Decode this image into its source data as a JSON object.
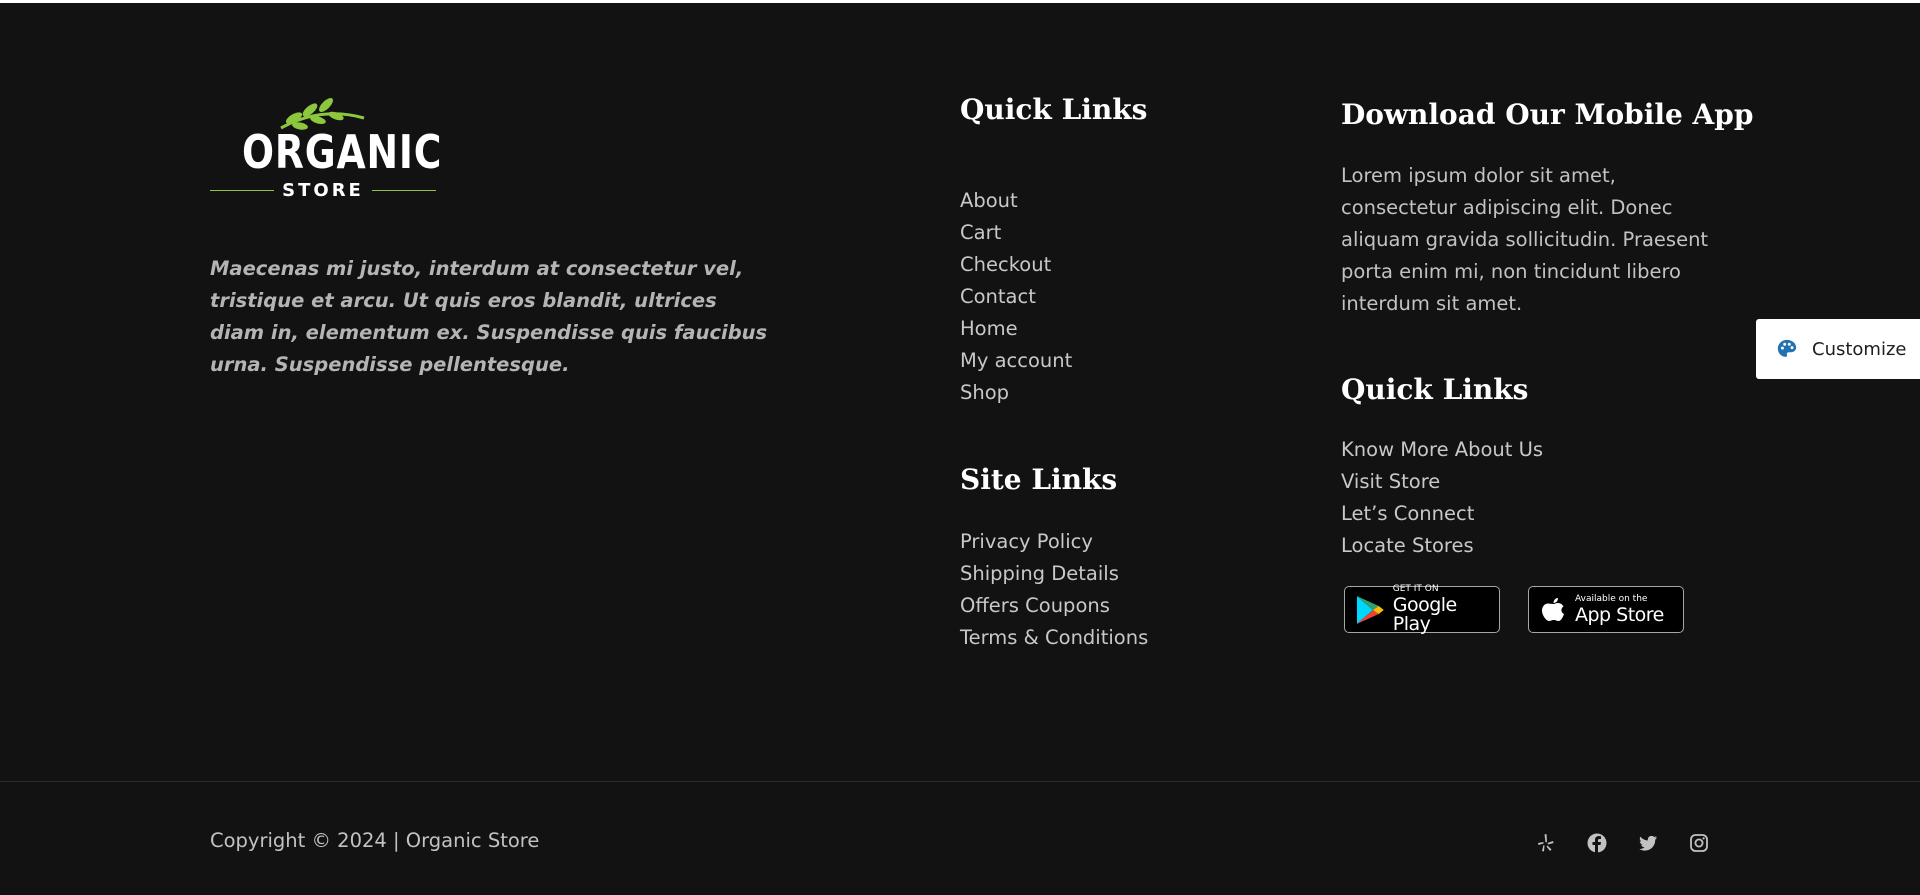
{
  "logo": {
    "word": "ORGANIC",
    "sub": "STORE",
    "leaf_color": "#8dc63f"
  },
  "about_text": "Maecenas mi justo, interdum at consectetur vel, tristique et arcu. Ut quis eros blandit, ultrices diam in, elementum ex. Suspendisse quis faucibus urna. Suspendisse pellentesque.",
  "quick_links": {
    "title": "Quick Links",
    "items": [
      "About",
      "Cart",
      "Checkout",
      "Contact",
      "Home",
      "My account",
      "Shop"
    ]
  },
  "site_links": {
    "title": "Site Links",
    "items": [
      "Privacy Policy",
      "Shipping Details",
      "Offers Coupons",
      "Terms & Conditions"
    ]
  },
  "app": {
    "title": "Download Our Mobile App",
    "description": "Lorem ipsum dolor sit amet, consectetur adipiscing elit. Donec aliquam gravida sollicitudin. Praesent porta enim mi, non tincidunt libero interdum sit amet."
  },
  "quick_links_2": {
    "title": "Quick Links",
    "items": [
      "Know More About Us",
      "Visit Store",
      "Let’s Connect",
      "Locate Stores"
    ]
  },
  "badges": {
    "google": {
      "small": "GET IT ON",
      "big": "Google Play",
      "icon": "google-play-icon"
    },
    "apple": {
      "small": "Available on the",
      "big": "App Store",
      "icon": "apple-icon"
    }
  },
  "customize": {
    "label": "Customize",
    "icon": "palette-icon",
    "icon_color": "#2271b1"
  },
  "copyright": "Copyright © 2024 | Organic Store",
  "social": [
    "yelp-icon",
    "facebook-icon",
    "twitter-icon",
    "instagram-icon"
  ],
  "colors": {
    "background": "#121212",
    "heading": "#ffffff",
    "link": "#c8c8c8",
    "accent": "#8dc63f"
  }
}
